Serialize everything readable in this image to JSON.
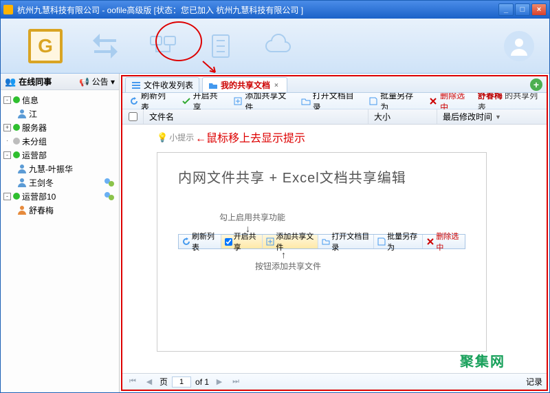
{
  "title": "杭州九慧科技有限公司 - oofile高级版  [状态：您已加入 杭州九慧科技有限公司 ]",
  "annot": {
    "myshare": "我的共享",
    "tip_arrow": "←鼠标移上去显示提示"
  },
  "sidebar": {
    "header": "在线同事",
    "announce": "公告",
    "nodes": [
      {
        "exp": "-",
        "dot": "green",
        "label": "信息"
      },
      {
        "child": true,
        "label": "江"
      },
      {
        "exp": "+",
        "dot": "green",
        "label": "服务器"
      },
      {
        "exp": "·",
        "dot": "grey",
        "label": "未分组"
      },
      {
        "exp": "-",
        "dot": "green",
        "label": "运营部"
      },
      {
        "child": true,
        "label": "九慧-叶振华"
      },
      {
        "child": true,
        "label": "王剑冬",
        "status": true
      },
      {
        "exp": "-",
        "dot": "green",
        "label": "运营部10",
        "status": true
      },
      {
        "child": true,
        "label": "舒春梅"
      }
    ]
  },
  "tabs": [
    {
      "label": "文件收发列表",
      "active": false
    },
    {
      "label": "我的共享文档",
      "active": true
    }
  ],
  "toolbar2": {
    "refresh": "刷新列表",
    "enable": "开启共享",
    "add": "添加共享文件",
    "opendir": "打开文档目录",
    "saveas": "批量另存为",
    "delete": "删除选中",
    "owner": "舒春梅",
    "owner_suffix": " 的共享列表"
  },
  "grid": {
    "col_name": "文件名",
    "col_size": "大小",
    "col_time": "最后修改时间"
  },
  "tip": {
    "label": "小提示"
  },
  "inner": {
    "title": "内网文件共享 + Excel文档共享编辑",
    "cap1": "勾上启用共享功能",
    "cap2": "按钮添加共享文件",
    "mini": {
      "refresh": "刷新列表",
      "enable": "开启共享",
      "add": "添加共享文件",
      "opendir": "打开文档目录",
      "saveas": "批量另存为",
      "delete": "删除选中"
    }
  },
  "pager": {
    "page_label_prefix": "页",
    "page": "1",
    "of": "of 1",
    "records": "记录"
  },
  "watermark": "聚集网"
}
